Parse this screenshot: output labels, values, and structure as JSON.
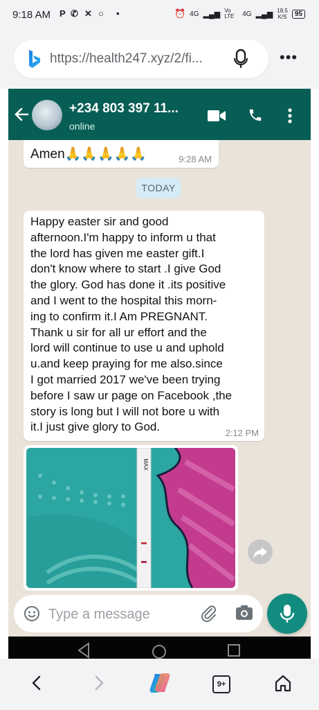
{
  "status_bar": {
    "time": "9:18 AM",
    "battery": "95",
    "speed_top": "18.5",
    "speed_unit": "K/S",
    "network_1": "4G",
    "network_2": "Vo LTE",
    "network_3": "4G"
  },
  "browser": {
    "url": "https://health247.xyz/2/fi...",
    "tab_count": "9+",
    "icons": [
      "bing-icon",
      "mic-icon",
      "more-icon",
      "back-icon",
      "forward-icon",
      "copilot-icon",
      "tabs-icon",
      "home-icon"
    ]
  },
  "chat_header": {
    "contact_name": "+234 803 397 11...",
    "status": "online",
    "icons": [
      "back-arrow-icon",
      "video-call-icon",
      "phone-icon",
      "more-vert-icon"
    ]
  },
  "messages": [
    {
      "text": "Amen🙏🙏🙏🙏🙏",
      "time": "9:28 AM"
    },
    {
      "date_chip": "TODAY"
    },
    {
      "text": "Happy easter sir and good\nafternoon.I'm happy to inform u that\nthe lord has given me easter gift.I\ndon't know where to start .I give God\nthe glory. God has done it .its positive\nand I went to the hospital this morn-\ning to confirm it.I Am PREGNANT.\nThank u sir for all ur effort and the\nlord will continue to use u and uphold\nu.and keep praying for me also.since\nI got married 2017 we've been trying\nbefore I saw ur page on Facebook ,the\nstory is long but I will not bore u with\nit.I just give glory to God.",
      "time": "2:12 PM"
    },
    {
      "image": "pregnancy-test-photo",
      "image_label": "MAX"
    }
  ],
  "composer": {
    "placeholder": "Type a message",
    "value": ""
  },
  "colors": {
    "wa_header": "#075e54",
    "wa_accent": "#128c7e",
    "chat_bg": "#e9e3da",
    "date_chip": "#d5ecf6"
  }
}
